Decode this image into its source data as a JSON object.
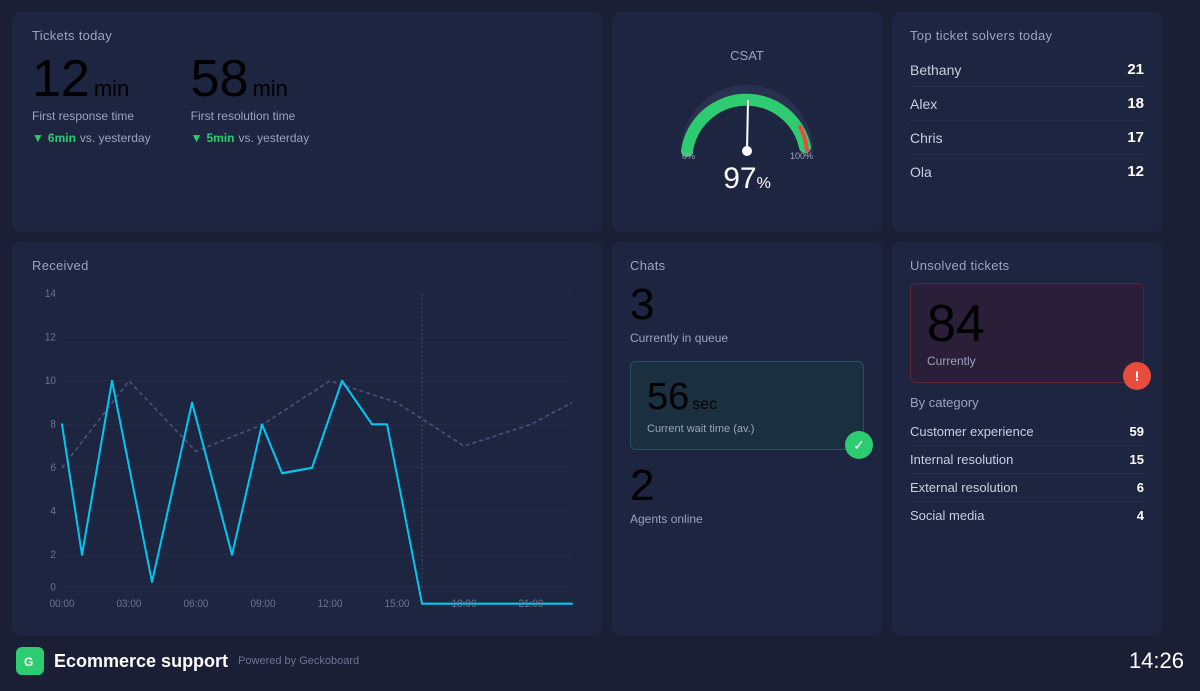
{
  "brand": {
    "name": "Ecommerce support",
    "powered_by": "Powered by Geckoboard",
    "icon": "G",
    "clock": "14:26"
  },
  "tickets_today": {
    "title": "Tickets today",
    "first_response": {
      "value": "12",
      "unit": "min",
      "label": "First response time",
      "change": "6min",
      "change_label": "vs. yesterday"
    },
    "first_resolution": {
      "value": "58",
      "unit": "min",
      "label": "First resolution time",
      "change": "5min",
      "change_label": "vs. yesterday"
    }
  },
  "csat": {
    "title": "CSAT",
    "value": "97",
    "unit": "%",
    "gauge_min": "0%",
    "gauge_max": "100%"
  },
  "top_solvers": {
    "title": "Top ticket solvers today",
    "solvers": [
      {
        "name": "Bethany",
        "count": "21"
      },
      {
        "name": "Alex",
        "count": "18"
      },
      {
        "name": "Chris",
        "count": "17"
      },
      {
        "name": "Ola",
        "count": "12"
      }
    ]
  },
  "received": {
    "title": "Received",
    "y_labels": [
      "0",
      "2",
      "4",
      "6",
      "8",
      "10",
      "12",
      "14"
    ],
    "x_labels": [
      "00:00",
      "03:00",
      "06:00",
      "09:00",
      "12:00",
      "15:00",
      "18:00",
      "21:00"
    ]
  },
  "chats": {
    "title": "Chats",
    "queue": {
      "value": "3",
      "label": "Currently in queue"
    },
    "wait_time": {
      "value": "56",
      "unit": "sec",
      "label": "Current wait time (av.)"
    },
    "agents": {
      "value": "2",
      "label": "Agents online"
    }
  },
  "unsolved": {
    "title": "Unsolved tickets",
    "current": {
      "value": "84",
      "label": "Currently"
    },
    "by_category_title": "By category",
    "categories": [
      {
        "name": "Customer experience",
        "count": "59"
      },
      {
        "name": "Internal resolution",
        "count": "15"
      },
      {
        "name": "External resolution",
        "count": "6"
      },
      {
        "name": "Social media",
        "count": "4"
      }
    ]
  },
  "colors": {
    "bg": "#16192e",
    "card": "#1e2540",
    "accent_green": "#2ecc71",
    "accent_red": "#e74c3c",
    "accent_cyan": "#00b8d4",
    "text_muted": "#9ba3bc",
    "chart_line": "#00c8f0",
    "chart_line_prev": "#4a5280"
  }
}
